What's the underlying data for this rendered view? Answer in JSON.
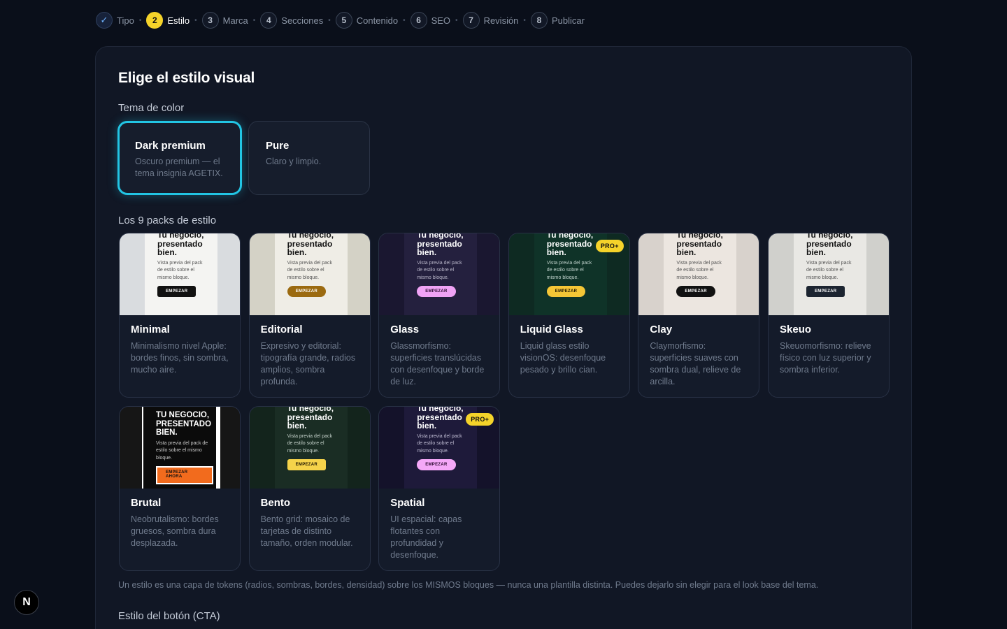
{
  "stepper": [
    {
      "num": "✓",
      "label": "Tipo",
      "state": "done"
    },
    {
      "num": "2",
      "label": "Estilo",
      "state": "active"
    },
    {
      "num": "3",
      "label": "Marca",
      "state": "todo"
    },
    {
      "num": "4",
      "label": "Secciones",
      "state": "todo"
    },
    {
      "num": "5",
      "label": "Contenido",
      "state": "todo"
    },
    {
      "num": "6",
      "label": "SEO",
      "state": "todo"
    },
    {
      "num": "7",
      "label": "Revisión",
      "state": "todo"
    },
    {
      "num": "8",
      "label": "Publicar",
      "state": "todo"
    }
  ],
  "step_separator": "•",
  "page": {
    "title": "Elige el estilo visual",
    "theme_label": "Tema de color",
    "packs_label": "Los 9 packs de estilo",
    "cta_label": "Estilo del botón (CTA)",
    "footnote": "Un estilo es una capa de tokens (radios, sombras, bordes, densidad) sobre los MISMOS bloques — nunca una plantilla distinta. Puedes dejarlo sin elegir para el look base del tema."
  },
  "themes": [
    {
      "name": "Dark premium",
      "desc": "Oscuro premium — el tema insignia AGETIX.",
      "selected": true
    },
    {
      "name": "Pure",
      "desc": "Claro y limpio.",
      "selected": false
    }
  ],
  "preview_text": {
    "headline": "Tu negocio, presentado bien.",
    "headline_caps": "TU NEGOCIO, PRESENTADO BIEN.",
    "body": "Vista previa del pack de estilo sobre el mismo bloque.",
    "cta": "EMPEZAR",
    "cta_caps": "EMPEZAR AHORA",
    "pro_badge": "PRO+"
  },
  "packs": [
    {
      "name": "Minimal",
      "desc": "Minimalismo nivel Apple: bordes finos, sin sombra, mucho aire.",
      "pro": false,
      "bg": "#d9dcdf",
      "sheet": "#f4f4f2",
      "ink": "#111111",
      "sub": "#555555",
      "btn": "#111111",
      "btnText": "#ffffff"
    },
    {
      "name": "Editorial",
      "desc": "Expresivo y editorial: tipografía grande, radios amplios, sombra profunda.",
      "pro": false,
      "bg": "#d4d2c6",
      "sheet": "#efede6",
      "ink": "#111111",
      "sub": "#555555",
      "btn": "#9b6a10",
      "btnText": "#ffffff"
    },
    {
      "name": "Glass",
      "desc": "Glassmorfismo: superficies translúcidas con desenfoque y borde de luz.",
      "pro": false,
      "bg": "#1a1730",
      "sheet": "#24203e",
      "ink": "#ffffff",
      "sub": "#b9b6c9",
      "btn": "#f0a3f5",
      "btnText": "#2a0a2e"
    },
    {
      "name": "Liquid Glass",
      "desc": "Liquid glass estilo visionOS: desenfoque pesado y brillo cian.",
      "pro": true,
      "bg": "#0e2a22",
      "sheet": "#0f3328",
      "ink": "#ffffff",
      "sub": "#c0d2cc",
      "btn": "#f5c636",
      "btnText": "#1a1200"
    },
    {
      "name": "Clay",
      "desc": "Claymorfismo: superficies suaves con sombra dual, relieve de arcilla.",
      "pro": false,
      "bg": "#d8d2cc",
      "sheet": "#ece6e0",
      "ink": "#111111",
      "sub": "#555555",
      "btn": "#111111",
      "btnText": "#ffffff"
    },
    {
      "name": "Skeuo",
      "desc": "Skeuomorfismo: relieve físico con luz superior y sombra inferior.",
      "pro": false,
      "bg": "#d0d0cc",
      "sheet": "#e9e8e4",
      "ink": "#111111",
      "sub": "#555555",
      "btn": "#1c2430",
      "btnText": "#ffffff"
    },
    {
      "name": "Brutal",
      "desc": "Neobrutalismo: bordes gruesos, sombra dura desplazada.",
      "pro": false,
      "bg": "#161616",
      "sheet": "#0b0b0b",
      "ink": "#ffffff",
      "sub": "#cccccc",
      "btn": "#f26b1d",
      "btnText": "#111111"
    },
    {
      "name": "Bento",
      "desc": "Bento grid: mosaico de tarjetas de distinto tamaño, orden modular.",
      "pro": false,
      "bg": "#13241c",
      "sheet": "#1a2d24",
      "ink": "#ffffff",
      "sub": "#c6d3cc",
      "btn": "#f5d34a",
      "btnText": "#1a1200"
    },
    {
      "name": "Spatial",
      "desc": "UI espacial: capas flotantes con profundidad y desenfoque.",
      "pro": true,
      "bg": "#14122a",
      "sheet": "#1e1a3a",
      "ink": "#ffffff",
      "sub": "#c0bdd4",
      "btn": "#f5a8f8",
      "btnText": "#2a0a2e"
    }
  ],
  "colors": {
    "accent": "#22c5e4",
    "active_step": "#f5d32a",
    "panel": "#111725"
  },
  "fab": {
    "letter": "N",
    "icon": "nextjs-icon"
  }
}
